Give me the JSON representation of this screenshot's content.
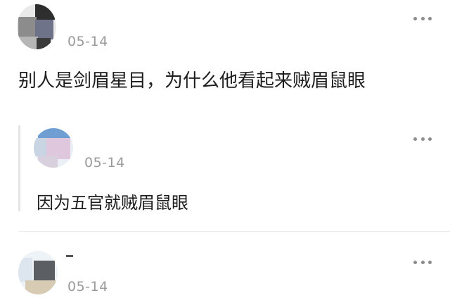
{
  "comments": [
    {
      "date": "05-14",
      "text": "别人是剑眉星目，为什么他看起来贼眉鼠眼"
    },
    {
      "date": "05-14",
      "text": "因为五官就贼眉鼠眼"
    },
    {
      "date": "05-14",
      "text": ""
    }
  ],
  "icons": {
    "more": "more-dots-icon"
  }
}
